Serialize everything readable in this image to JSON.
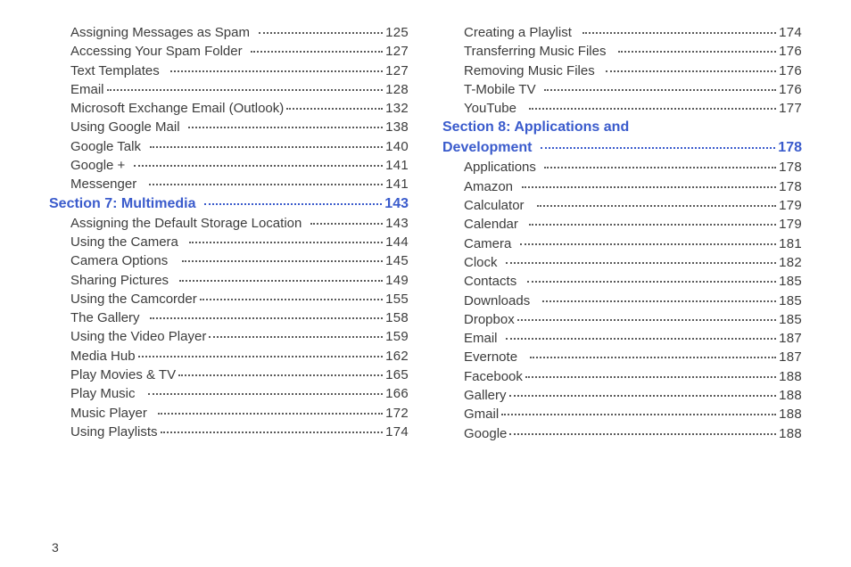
{
  "pageNumber": "3",
  "leftColumn": [
    {
      "type": "entry",
      "label": "Assigning Messages as Spam",
      "page": "125",
      "pad": 3
    },
    {
      "type": "entry",
      "label": "Accessing Your Spam Folder",
      "page": "127",
      "pad": 3
    },
    {
      "type": "entry",
      "label": "Text Templates",
      "page": "127",
      "pad": 4
    },
    {
      "type": "entry",
      "label": "Email",
      "page": "128",
      "pad": 0
    },
    {
      "type": "entry",
      "label": "Microsoft Exchange Email (Outlook)",
      "page": "132",
      "pad": 0
    },
    {
      "type": "entry",
      "label": "Using Google Mail",
      "page": "138",
      "pad": 3
    },
    {
      "type": "entry",
      "label": "Google Talk",
      "page": "140",
      "pad": 3
    },
    {
      "type": "entry",
      "label": "Google +",
      "page": "141",
      "pad": 3
    },
    {
      "type": "entry",
      "label": "Messenger",
      "page": "141",
      "pad": 5
    },
    {
      "type": "section",
      "label": "Section 7:  Multimedia",
      "page": "143",
      "pad": 3
    },
    {
      "type": "entry",
      "label": "Assigning the Default Storage Location",
      "page": "143",
      "pad": 3
    },
    {
      "type": "entry",
      "label": "Using the Camera",
      "page": "144",
      "pad": 4
    },
    {
      "type": "entry",
      "label": "Camera Options",
      "page": "145",
      "pad": 6
    },
    {
      "type": "entry",
      "label": "Sharing Pictures",
      "page": "149",
      "pad": 4
    },
    {
      "type": "entry",
      "label": "Using the Camcorder",
      "page": "155",
      "pad": 0
    },
    {
      "type": "entry",
      "label": "The Gallery",
      "page": "158",
      "pad": 4
    },
    {
      "type": "entry",
      "label": "Using the Video Player",
      "page": "159",
      "pad": 0
    },
    {
      "type": "entry",
      "label": "Media Hub",
      "page": "162",
      "pad": 0
    },
    {
      "type": "entry",
      "label": "Play Movies & TV",
      "page": "165",
      "pad": 0
    },
    {
      "type": "entry",
      "label": "Play Music",
      "page": "166",
      "pad": 5
    },
    {
      "type": "entry",
      "label": "Music Player",
      "page": "172",
      "pad": 4
    },
    {
      "type": "entry",
      "label": "Using Playlists",
      "page": "174",
      "pad": 0
    }
  ],
  "rightColumn": [
    {
      "type": "entry",
      "label": "Creating a Playlist",
      "page": "174",
      "pad": 4
    },
    {
      "type": "entry",
      "label": "Transferring Music Files",
      "page": "176",
      "pad": 5
    },
    {
      "type": "entry",
      "label": "Removing Music Files",
      "page": "176",
      "pad": 4
    },
    {
      "type": "entry",
      "label": "T-Mobile TV",
      "page": "176",
      "pad": 3
    },
    {
      "type": "entry",
      "label": "YouTube",
      "page": "177",
      "pad": 5
    },
    {
      "type": "section-line1",
      "label": "Section 8:  Applications and"
    },
    {
      "type": "section",
      "label": "Development",
      "page": "178",
      "pad": 3
    },
    {
      "type": "entry",
      "label": "Applications",
      "page": "178",
      "pad": 3
    },
    {
      "type": "entry",
      "label": "Amazon",
      "page": "178",
      "pad": 3
    },
    {
      "type": "entry",
      "label": "Calculator",
      "page": "179",
      "pad": 5
    },
    {
      "type": "entry",
      "label": "Calendar",
      "page": "179",
      "pad": 4
    },
    {
      "type": "entry",
      "label": "Camera",
      "page": "181",
      "pad": 3
    },
    {
      "type": "entry",
      "label": "Clock",
      "page": "182",
      "pad": 3
    },
    {
      "type": "entry",
      "label": "Contacts",
      "page": "185",
      "pad": 4
    },
    {
      "type": "entry",
      "label": "Downloads",
      "page": "185",
      "pad": 5
    },
    {
      "type": "entry",
      "label": "Dropbox",
      "page": "185",
      "pad": 0
    },
    {
      "type": "entry",
      "label": "Email",
      "page": "187",
      "pad": 3
    },
    {
      "type": "entry",
      "label": "Evernote",
      "page": "187",
      "pad": 5
    },
    {
      "type": "entry",
      "label": "Facebook",
      "page": "188",
      "pad": 0
    },
    {
      "type": "entry",
      "label": "Gallery",
      "page": "188",
      "pad": 0
    },
    {
      "type": "entry",
      "label": "Gmail",
      "page": "188",
      "pad": 0
    },
    {
      "type": "entry",
      "label": "Google",
      "page": "188",
      "pad": 0
    }
  ]
}
